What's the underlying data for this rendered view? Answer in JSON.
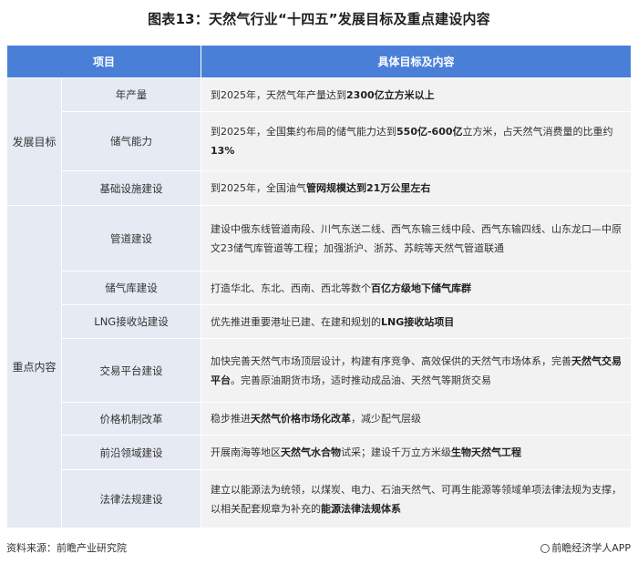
{
  "title": "图表13：天然气行业“十四五”发展目标及重点建设内容",
  "header": {
    "col_item": "项目",
    "col_content": "具体目标及内容"
  },
  "sections": [
    {
      "category": "发展目标"
    },
    {
      "category": "重点内容"
    }
  ],
  "rows": [
    {
      "item": "年产量",
      "parts": [
        {
          "t": "到2025年，天然气年产量达到",
          "b": false
        },
        {
          "t": "2300亿立方米以上",
          "b": true
        }
      ]
    },
    {
      "item": "储气能力",
      "parts": [
        {
          "t": "到2025年，全国集约布局的储气能力达到",
          "b": false
        },
        {
          "t": "550亿-600亿",
          "b": true
        },
        {
          "t": "立方米，占天然气消费量的比重约",
          "b": false
        },
        {
          "t": "13%",
          "b": true
        }
      ]
    },
    {
      "item": "基础设施建设",
      "parts": [
        {
          "t": "到2025年，全国油气",
          "b": false
        },
        {
          "t": "管网规模达到21万公里左右",
          "b": true
        }
      ]
    },
    {
      "item": "管道建设",
      "parts": [
        {
          "t": "建设中俄东线管道南段、川气东送二线、西气东输三线中段、西气东输四线、山东龙口—中原文23储气库管道等工程；加强浙沪、浙苏、苏皖等天然气管道联通",
          "b": false
        }
      ]
    },
    {
      "item": "储气库建设",
      "parts": [
        {
          "t": "打造华北、东北、西南、西北等数个",
          "b": false
        },
        {
          "t": "百亿方级地下储气库群",
          "b": true
        }
      ]
    },
    {
      "item": "LNG接收站建设",
      "parts": [
        {
          "t": "优先推进重要港址已建、在建和规划的",
          "b": false
        },
        {
          "t": "LNG接收站项目",
          "b": true
        }
      ]
    },
    {
      "item": "交易平台建设",
      "parts": [
        {
          "t": "加快完善天然气市场顶层设计，构建有序竞争、高效保供的天然气市场体系，完善",
          "b": false
        },
        {
          "t": "天然气交易平台",
          "b": true
        },
        {
          "t": "。完善原油期货市场，适时推动成品油、天然气等期货交易",
          "b": false
        }
      ]
    },
    {
      "item": "价格机制改革",
      "parts": [
        {
          "t": "稳步推进",
          "b": false
        },
        {
          "t": "天然气价格市场化改革",
          "b": true
        },
        {
          "t": "，减少配气层级",
          "b": false
        }
      ]
    },
    {
      "item": "前沿领域建设",
      "parts": [
        {
          "t": "开展南海等地区",
          "b": false
        },
        {
          "t": "天然气水合物",
          "b": true
        },
        {
          "t": "试采；建设千万立方米级",
          "b": false
        },
        {
          "t": "生物天然气工程",
          "b": true
        }
      ]
    },
    {
      "item": "法律法规建设",
      "parts": [
        {
          "t": "建立以能源法为统领，以煤炭、电力、石油天然气、可再生能源等领域单项法律法规为支撑，以相关配套规章为补充的",
          "b": false
        },
        {
          "t": "能源法律法规体系",
          "b": true
        }
      ]
    }
  ],
  "footer": {
    "source": "资料来源：前瞻产业研究院",
    "brand": "前瞻经济学人APP"
  }
}
